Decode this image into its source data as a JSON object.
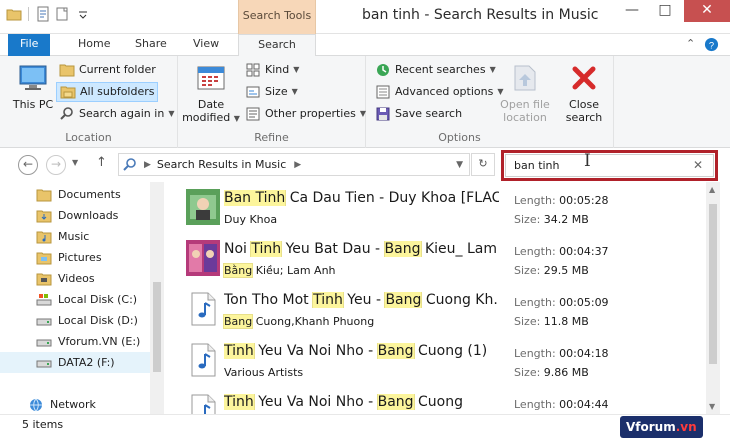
{
  "window": {
    "title": "ban tinh - Search Results in Music",
    "context_tab": "Search Tools",
    "minimize": "—",
    "maximize": "□",
    "close": "✕"
  },
  "ribbon_tabs": [
    "File",
    "Home",
    "Share",
    "View",
    "Search"
  ],
  "ribbon": {
    "location": {
      "label": "Location",
      "this_pc": "This PC",
      "current_folder": "Current folder",
      "all_subfolders": "All subfolders",
      "search_again_in": "Search again in"
    },
    "refine": {
      "label": "Refine",
      "date_modified": "Date modified",
      "kind": "Kind",
      "size": "Size",
      "other_properties": "Other properties"
    },
    "options": {
      "label": "Options",
      "recent_searches": "Recent searches",
      "advanced_options": "Advanced options",
      "save_search": "Save search",
      "open_file_location": "Open file location",
      "close_search": "Close search"
    }
  },
  "address": {
    "breadcrumb": "Search Results in Music",
    "search_query": "ban tinh"
  },
  "nav_pane": {
    "items": [
      "Documents",
      "Downloads",
      "Music",
      "Pictures",
      "Videos",
      "Local Disk (C:)",
      "Local Disk (D:)",
      "Vforum.VN (E:)",
      "DATA2 (F:)"
    ],
    "network": "Network"
  },
  "results": [
    {
      "title_parts": [
        {
          "t": "Ban Tinh",
          "h": true
        },
        {
          "t": " Ca Dau Tien - Duy Khoa [FLAC",
          "h": false
        }
      ],
      "artist_parts": [
        {
          "t": "Duy Khoa",
          "h": false
        }
      ],
      "length_label": "Length:",
      "length": "00:05:28",
      "size_label": "Size:",
      "size": "34.2 MB",
      "thumb": "album-art-1"
    },
    {
      "title_parts": [
        {
          "t": "Noi ",
          "h": false
        },
        {
          "t": "Tinh",
          "h": true
        },
        {
          "t": " Yeu Bat Dau - ",
          "h": false
        },
        {
          "t": "Bang",
          "h": true
        },
        {
          "t": " Kieu_ Lam ...",
          "h": false
        }
      ],
      "artist_parts": [
        {
          "t": "Bằng",
          "h": true
        },
        {
          "t": " Kiều; Lam Anh",
          "h": false
        }
      ],
      "length_label": "Length:",
      "length": "00:04:37",
      "size_label": "Size:",
      "size": "29.5 MB",
      "thumb": "album-art-2"
    },
    {
      "title_parts": [
        {
          "t": "Ton Tho Mot ",
          "h": false
        },
        {
          "t": "Tinh",
          "h": true
        },
        {
          "t": " Yeu - ",
          "h": false
        },
        {
          "t": "Bang",
          "h": true
        },
        {
          "t": " Cuong Kh...",
          "h": false
        }
      ],
      "artist_parts": [
        {
          "t": "Bang",
          "h": true
        },
        {
          "t": " Cuong,Khanh Phuong",
          "h": false
        }
      ],
      "length_label": "Length:",
      "length": "00:05:09",
      "size_label": "Size:",
      "size": "11.8 MB",
      "thumb": "music-file-icon"
    },
    {
      "title_parts": [
        {
          "t": "Tinh",
          "h": true
        },
        {
          "t": " Yeu Va Noi Nho - ",
          "h": false
        },
        {
          "t": "Bang",
          "h": true
        },
        {
          "t": " Cuong (1)",
          "h": false
        }
      ],
      "artist_parts": [
        {
          "t": "Various Artists",
          "h": false
        }
      ],
      "length_label": "Length:",
      "length": "00:04:18",
      "size_label": "Size:",
      "size": "9.86 MB",
      "thumb": "music-file-icon"
    },
    {
      "title_parts": [
        {
          "t": "Tinh",
          "h": true
        },
        {
          "t": " Yeu Va Noi Nho - ",
          "h": false
        },
        {
          "t": "Bang",
          "h": true
        },
        {
          "t": " Cuong",
          "h": false
        }
      ],
      "artist_parts": [],
      "length_label": "Length:",
      "length": "00:04:44",
      "size_label": "",
      "size": "",
      "thumb": "music-file-icon"
    }
  ],
  "status": {
    "count": "5 items"
  },
  "watermark": {
    "text_main": "Vforum",
    "text_dot": ".vn"
  },
  "colors": {
    "file_tab": "#1979ca",
    "context_tab": "#f7d7b8",
    "highlight": "#fcf59c",
    "search_box_outline": "#b0212a",
    "selected_button": "#cde8ff"
  }
}
